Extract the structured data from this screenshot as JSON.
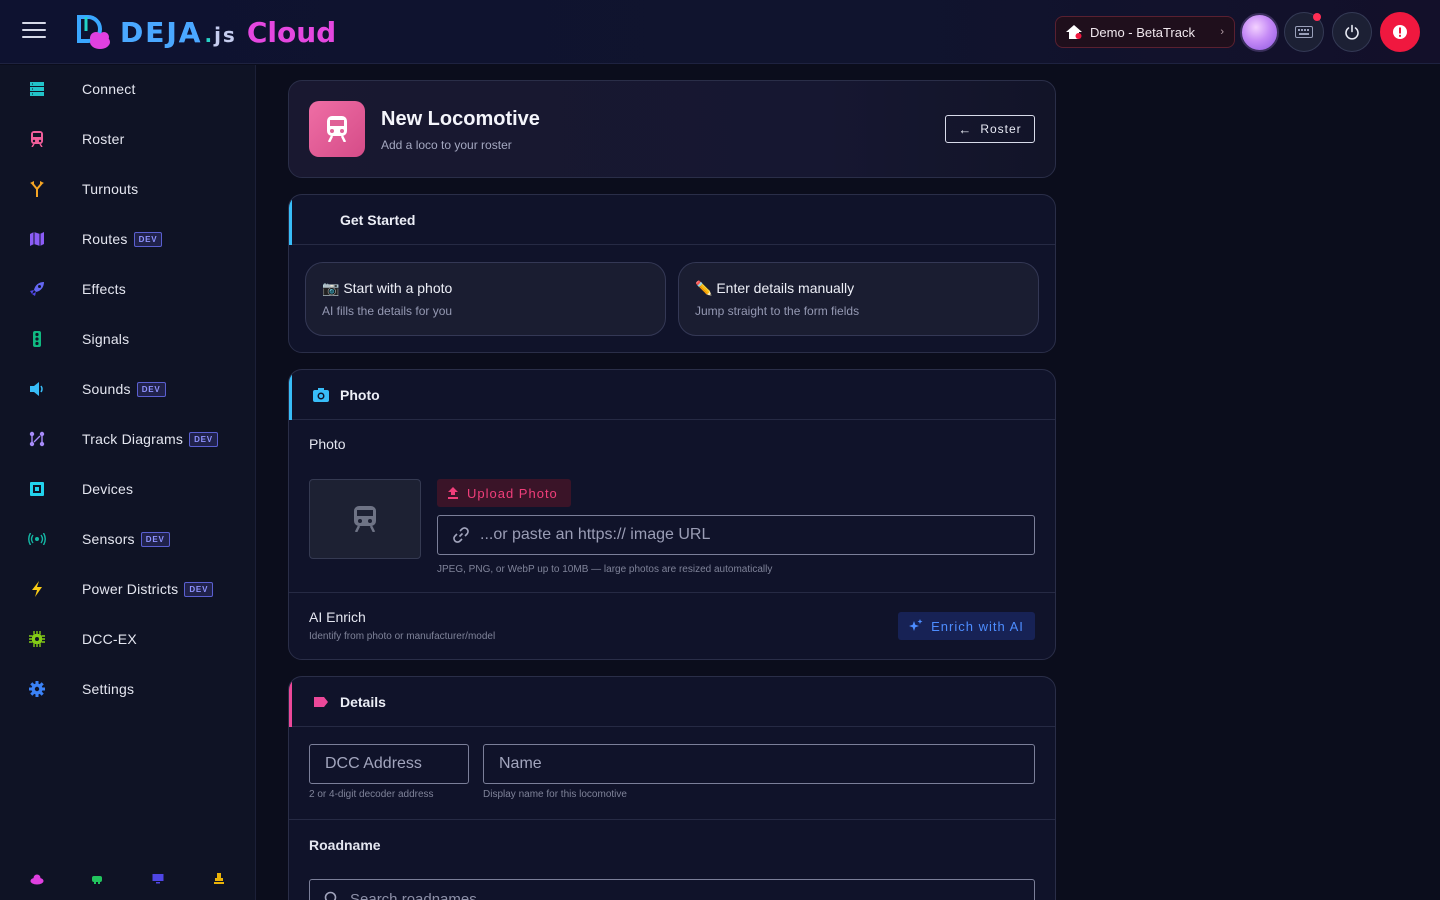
{
  "header": {
    "logo": {
      "deja": "DEJA",
      "js": "js",
      "cloud": "Cloud"
    },
    "location": "Demo - BetaTrack"
  },
  "sidebar": {
    "items": [
      {
        "label": "Connect",
        "icon": "server-icon",
        "color": "#22c3c9"
      },
      {
        "label": "Roster",
        "icon": "train-icon",
        "color": "#f05e9a"
      },
      {
        "label": "Turnouts",
        "icon": "fork-icon",
        "color": "#f5a524"
      },
      {
        "label": "Routes",
        "icon": "map-icon",
        "color": "#8b5cf6",
        "badge": "DEV"
      },
      {
        "label": "Effects",
        "icon": "rocket-icon",
        "color": "#6366f1"
      },
      {
        "label": "Signals",
        "icon": "traffic-light-icon",
        "color": "#10b981"
      },
      {
        "label": "Sounds",
        "icon": "speaker-icon",
        "color": "#38bdf8",
        "badge": "DEV"
      },
      {
        "label": "Track Diagrams",
        "icon": "graph-icon",
        "color": "#a78bfa",
        "badge": "DEV"
      },
      {
        "label": "Devices",
        "icon": "chip-icon",
        "color": "#22d3ee"
      },
      {
        "label": "Sensors",
        "icon": "broadcast-icon",
        "color": "#14b8a6",
        "badge": "DEV"
      },
      {
        "label": "Power Districts",
        "icon": "bolt-icon",
        "color": "#facc15",
        "badge": "DEV"
      },
      {
        "label": "DCC-EX",
        "icon": "cpu-icon",
        "color": "#84cc16"
      },
      {
        "label": "Settings",
        "icon": "gear-icon",
        "color": "#3b82f6"
      }
    ]
  },
  "hero": {
    "title": "New Locomotive",
    "subtitle": "Add a loco to your roster",
    "back_label": "Roster"
  },
  "get_started": {
    "title": "Get Started",
    "options": [
      {
        "emoji": "📷",
        "title": "Start with a photo",
        "subtitle": "AI fills the details for you"
      },
      {
        "emoji": "✏️",
        "title": "Enter details manually",
        "subtitle": "Jump straight to the form fields"
      }
    ]
  },
  "photo": {
    "title": "Photo",
    "field_label": "Photo",
    "upload_label": "Upload Photo",
    "url_placeholder": "...or paste an https:// image URL",
    "hint": "JPEG, PNG, or WebP up to 10MB — large photos are resized automatically",
    "ai_title": "AI Enrich",
    "ai_subtitle": "Identify from photo or manufacturer/model",
    "enrich_label": "Enrich with AI"
  },
  "details": {
    "title": "Details",
    "dcc_placeholder": "DCC Address",
    "dcc_hint": "2 or 4-digit decoder address",
    "name_placeholder": "Name",
    "name_hint": "Display name for this locomotive",
    "roadname_label": "Roadname",
    "roadname_placeholder": "Search roadnames..."
  },
  "colors": {
    "roster_accent": "#e8619c",
    "photo_accent": "#38bdf8",
    "details_accent": "#ec4899",
    "alert": "#f0183f"
  }
}
